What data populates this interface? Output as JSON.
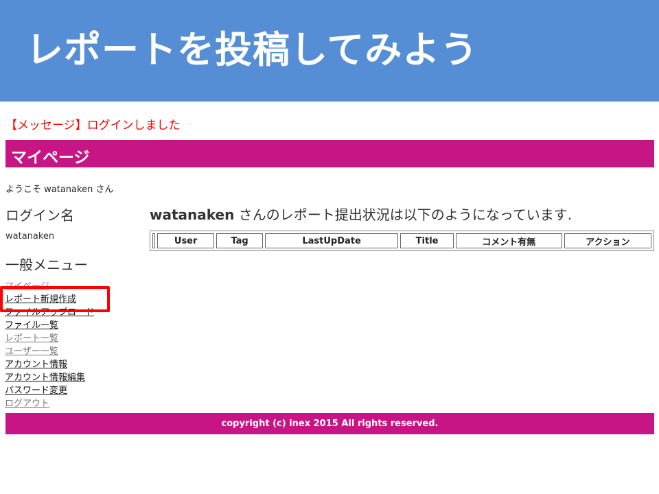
{
  "slide": {
    "title": "レポートを投稿してみよう",
    "header_color": "#558ed5"
  },
  "message": "【メッセージ】ログインしました",
  "mypage": {
    "title": "マイページ",
    "bar_color": "#c71585"
  },
  "welcome": "ようこそ watanaken さん",
  "sidebar": {
    "login_heading": "ログイン名",
    "login_value": "watanaken",
    "menu_heading": "一般メニュー",
    "items": [
      {
        "label": "マイページ"
      },
      {
        "label": "レポート新規作成",
        "highlighted": true
      },
      {
        "label": "ファイルアップロード"
      },
      {
        "label": "ファイル一覧"
      },
      {
        "label": "レポート一覧"
      },
      {
        "label": "ユーザー一覧"
      },
      {
        "label": "アカウント情報"
      },
      {
        "label": "アカウント情報編集"
      },
      {
        "label": "パスワード変更"
      },
      {
        "label": "ログアウト"
      }
    ]
  },
  "main": {
    "user_name": "watanaken",
    "heading_rest": " さんのレポート提出状況は以下のようになっています.",
    "table": {
      "columns": [
        "",
        "User",
        "Tag",
        "LastUpDate",
        "Title",
        "コメント有無",
        "アクション"
      ],
      "rows": []
    }
  },
  "footer": {
    "text": "copyright (c) inex 2015 All rights reserved."
  }
}
